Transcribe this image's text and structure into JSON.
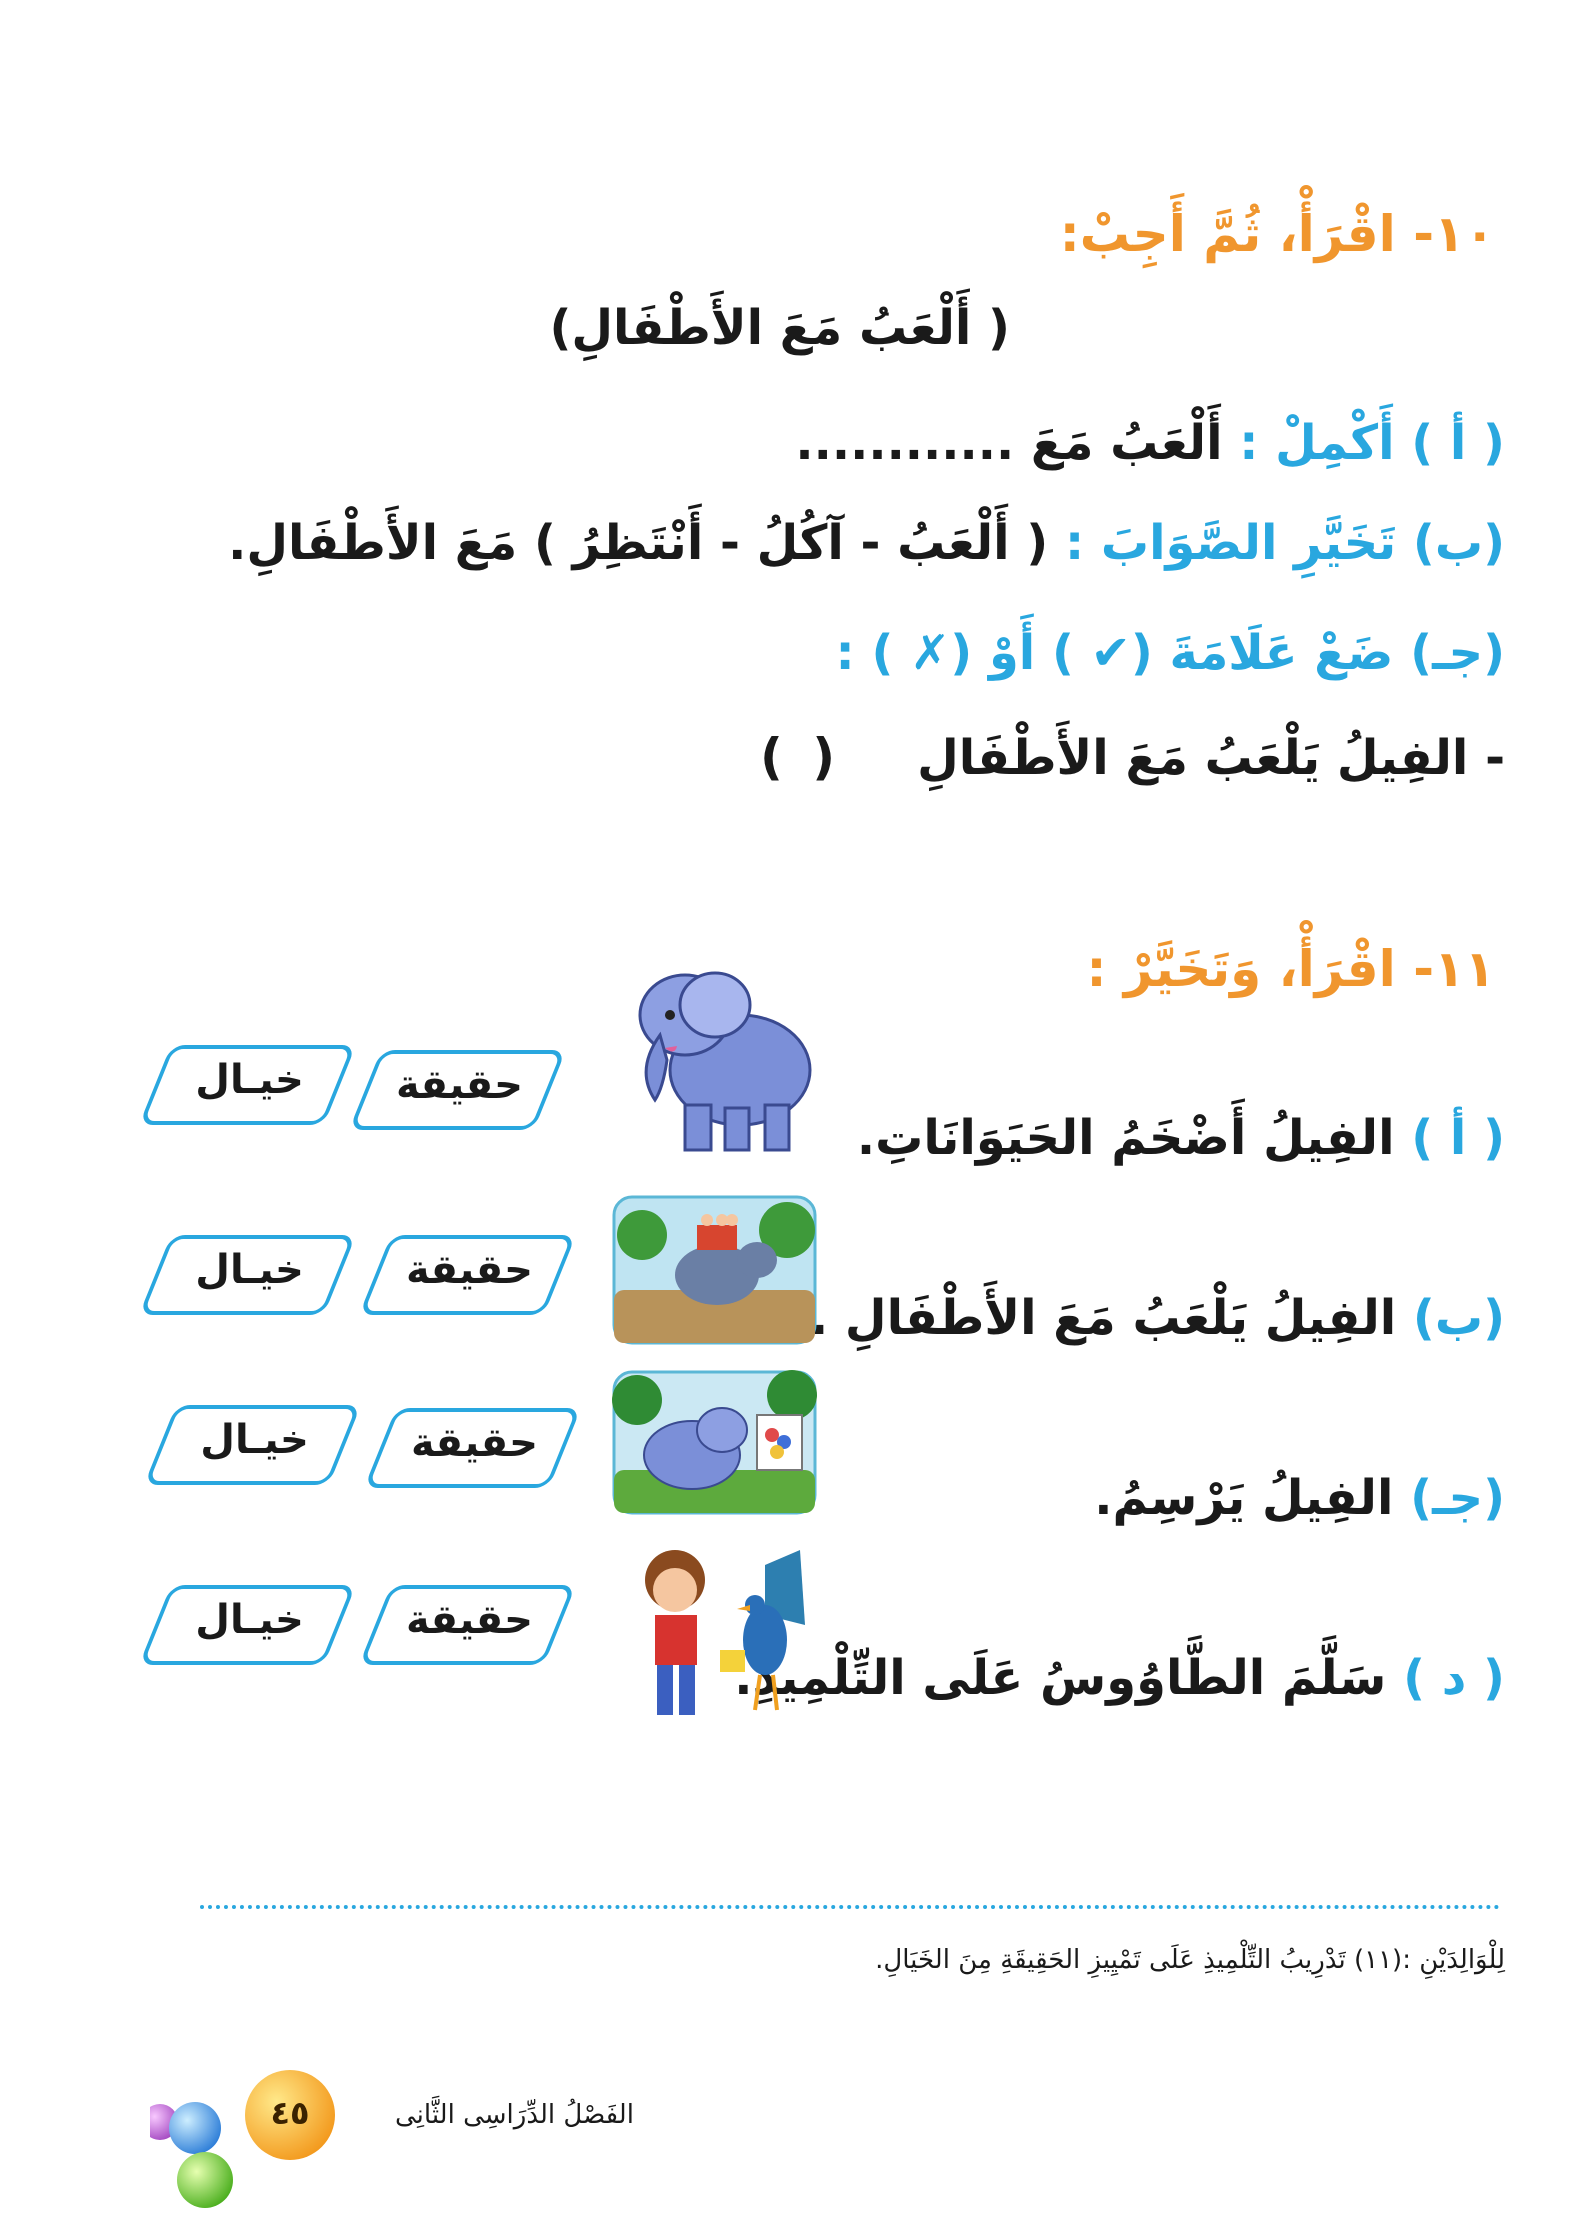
{
  "q10": {
    "number": "١٠-",
    "instruction": "اقْرَأْ، ثُمَّ أَجِبْ:",
    "story_title": "( أَلْعَبُ مَعَ الأَطْفَالِ)",
    "a": {
      "label": "( أ ) أَكْمِلْ :",
      "text": "أَلْعَبُ مَعَ ............"
    },
    "b": {
      "label": "(ب) تَخَيَّرِ الصَّوَابَ :",
      "text": "( أَلْعَبُ  -  آكُلُ  -  أَنْتَظِرُ ) مَعَ الأَطْفَالِ."
    },
    "c": {
      "label": "(جـ) ضَعْ عَلَامَةَ (✔ ) أَوْ (✗ ) :",
      "statement": "- الفِيلُ يَلْعَبُ مَعَ الأَطْفَالِ",
      "answer_box": "(      )"
    }
  },
  "q11": {
    "number": "١١-",
    "instruction": "اقْرَأْ، وَتَخَيَّرْ :",
    "items": [
      {
        "label": "( أ )",
        "text": "الفِيلُ أَضْخَمُ الحَيَوَانَاتِ.",
        "opt_real": "حقيقة",
        "opt_fantasy": "خيـال",
        "image": "elephant-standing"
      },
      {
        "label": "(ب)",
        "text": "الفِيلُ يَلْعَبُ مَعَ الأَطْفَالِ .",
        "opt_real": "حقيقة",
        "opt_fantasy": "خيـال",
        "image": "elephant-carrying-children"
      },
      {
        "label": "(جـ)",
        "text": "الفِيلُ يَرْسِمُ.",
        "opt_real": "حقيقة",
        "opt_fantasy": "خيـال",
        "image": "elephant-painting"
      },
      {
        "label": "( د )",
        "text": "سَلَّمَ الطَّاوُوسُ عَلَى التِّلْمِيذِ.",
        "opt_real": "حقيقة",
        "opt_fantasy": "خيـال",
        "image": "peacock-and-student"
      }
    ]
  },
  "parents_note": "لِلْوَالِدَيْنِ :(١١) تَدْرِيبُ التِّلْمِيذِ عَلَى  تَمْيِيزِ  الحَقِيقَةِ مِنَ الخَيَالِ.",
  "footer": {
    "term": "الفَصْلُ الدِّرَاسِى الثَّانِى",
    "page_number": "٤٥"
  },
  "colors": {
    "orange": "#f0962e",
    "blue": "#29a7df",
    "text": "#1a1a1a"
  }
}
